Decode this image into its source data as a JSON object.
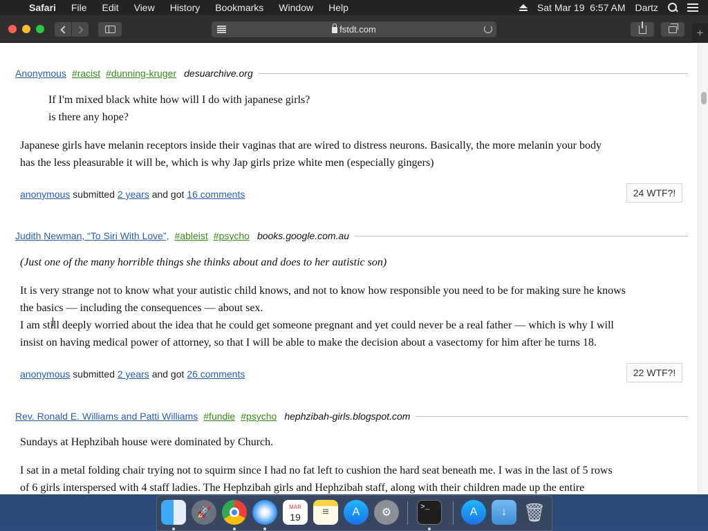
{
  "menubar": {
    "app_name": "Safari",
    "menus": [
      "File",
      "Edit",
      "View",
      "History",
      "Bookmarks",
      "Window",
      "Help"
    ],
    "datetime": "Sat Mar 19  6:57 AM",
    "user": "Dartz"
  },
  "browser": {
    "url": "fstdt.com"
  },
  "posts": [
    {
      "author": "Anonymous",
      "tags": [
        "#racist",
        "#dunning-kruger"
      ],
      "source": "desuarchive.org",
      "quote_lines": [
        "If I'm mixed black white how will I do with japanese girls?",
        "is there any hope?"
      ],
      "body_lines": [
        "Japanese girls have melanin receptors inside their vaginas that are wired to distress neurons. Basically, the more melanin your body",
        "has the less pleasurable it will be, which is why Jap girls prize white men (especially gingers)"
      ],
      "submitter": "anonymous",
      "submitted_word": "submitted",
      "age": "2 years",
      "got_word": "and got",
      "comments": "16 comments",
      "wtf": "24 WTF?!"
    },
    {
      "author": "Judith Newman, “To Siri With Love”,",
      "tags": [
        "#ableist",
        "#psycho"
      ],
      "source": "books.google.com.au",
      "intro": "(Just one of the many horrible things she thinks about and does to her autistic son)",
      "body_lines": [
        "It is very strange not to know what your autistic child knows, and not to know how responsible you need to be for making sure he knows",
        "the basics — including the consequences — about sex.",
        "I am still deeply worried about the idea that he could get someone pregnant and yet could never be a real father — which is why I will",
        "insist on having medical power of attorney, so that I will be able to make the decision about a vasectomy for him after he turns 18."
      ],
      "submitter": "anonymous",
      "submitted_word": "submitted",
      "age": "2 years",
      "got_word": "and got",
      "comments": "26 comments",
      "wtf": "22 WTF?!"
    },
    {
      "author": "Rev. Ronald E. Williams and Patti Williams",
      "tags": [
        "#fundie",
        "#psycho"
      ],
      "source": "hephzibah-girls.blogspot.com",
      "first_line": "Sundays at Hephzibah house were dominated by Church.",
      "body_lines": [
        "I sat in a metal folding chair trying not to squirm since I had no fat left to cushion the hard seat beneath me. I was in the last of 5 rows",
        "of 6 girls interspersed with 4 staff ladies. The Hephzibah girls and Hephzibah staff, along with their children made up the entire"
      ]
    }
  ],
  "dock": {
    "calendar_month": "MAR",
    "calendar_day": "19",
    "items": [
      "Finder",
      "Launchpad",
      "Chrome",
      "Safari",
      "Calendar",
      "Notes",
      "App Store",
      "System Preferences",
      "Terminal",
      "App Store",
      "Downloads",
      "Trash"
    ]
  }
}
